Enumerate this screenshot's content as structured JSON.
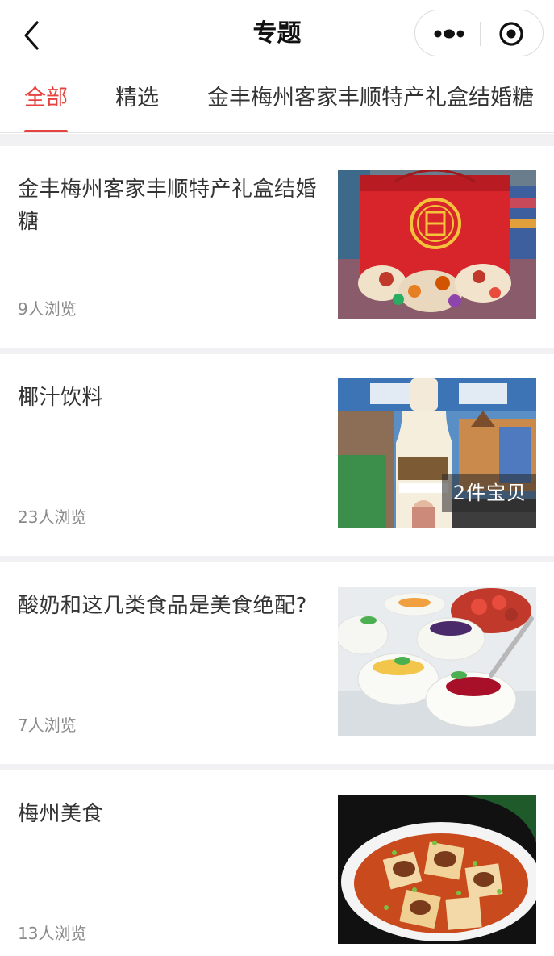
{
  "nav": {
    "title": "专题",
    "back_icon": "chevron-left-icon",
    "more_icon": "more-dots-icon",
    "close_icon": "target-close-icon"
  },
  "tabs": [
    {
      "label": "全部",
      "active": true
    },
    {
      "label": "精选",
      "active": false
    },
    {
      "label": "金丰梅州客家丰顺特产礼盒结婚糖",
      "active": false
    }
  ],
  "accent_color": "#e64340",
  "articles": [
    {
      "title": "金丰梅州客家丰顺特产礼盒结婚糖",
      "views": "9人浏览",
      "badge": ""
    },
    {
      "title": "椰汁饮料",
      "views": "23人浏览",
      "badge": "2件宝贝"
    },
    {
      "title": "酸奶和这几类食品是美食绝配?",
      "views": "7人浏览",
      "badge": ""
    },
    {
      "title": "梅州美食",
      "views": "13人浏览",
      "badge": ""
    }
  ]
}
